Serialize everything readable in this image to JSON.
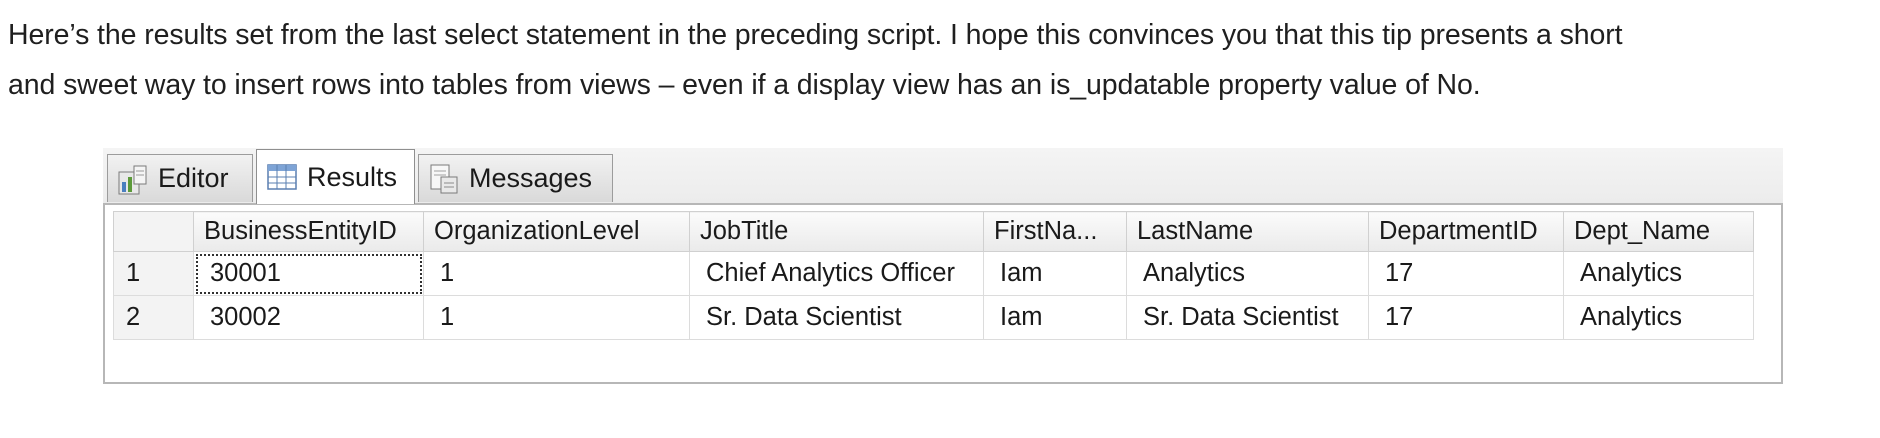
{
  "article": {
    "line1": "Here’s the results set from the last select statement in the preceding script.  I hope this convinces you that this tip presents a short",
    "line2": "and sweet way to insert rows into tables from views – even if a display view has an is_updatable property value of No."
  },
  "tabs": [
    {
      "label": "Editor",
      "icon": "editor-icon",
      "active": false
    },
    {
      "label": "Results",
      "icon": "results-grid-icon",
      "active": true
    },
    {
      "label": "Messages",
      "icon": "messages-icon",
      "active": false
    }
  ],
  "grid": {
    "columns": [
      "BusinessEntityID",
      "OrganizationLevel",
      "JobTitle",
      "FirstNa...",
      "LastName",
      "DepartmentID",
      "Dept_Name"
    ],
    "rows": [
      {
        "num": "1",
        "cells": [
          "30001",
          "1",
          "Chief Analytics Officer",
          "Iam",
          "Analytics",
          "17",
          "Analytics"
        ]
      },
      {
        "num": "2",
        "cells": [
          "30002",
          "1",
          "Sr. Data Scientist",
          "Iam",
          "Sr. Data Scientist",
          "17",
          "Analytics"
        ]
      }
    ]
  },
  "colors": {
    "tab_border": "#9c9c9c",
    "grid_line": "#dcdcdc",
    "header_bg": "#eaeaea"
  }
}
